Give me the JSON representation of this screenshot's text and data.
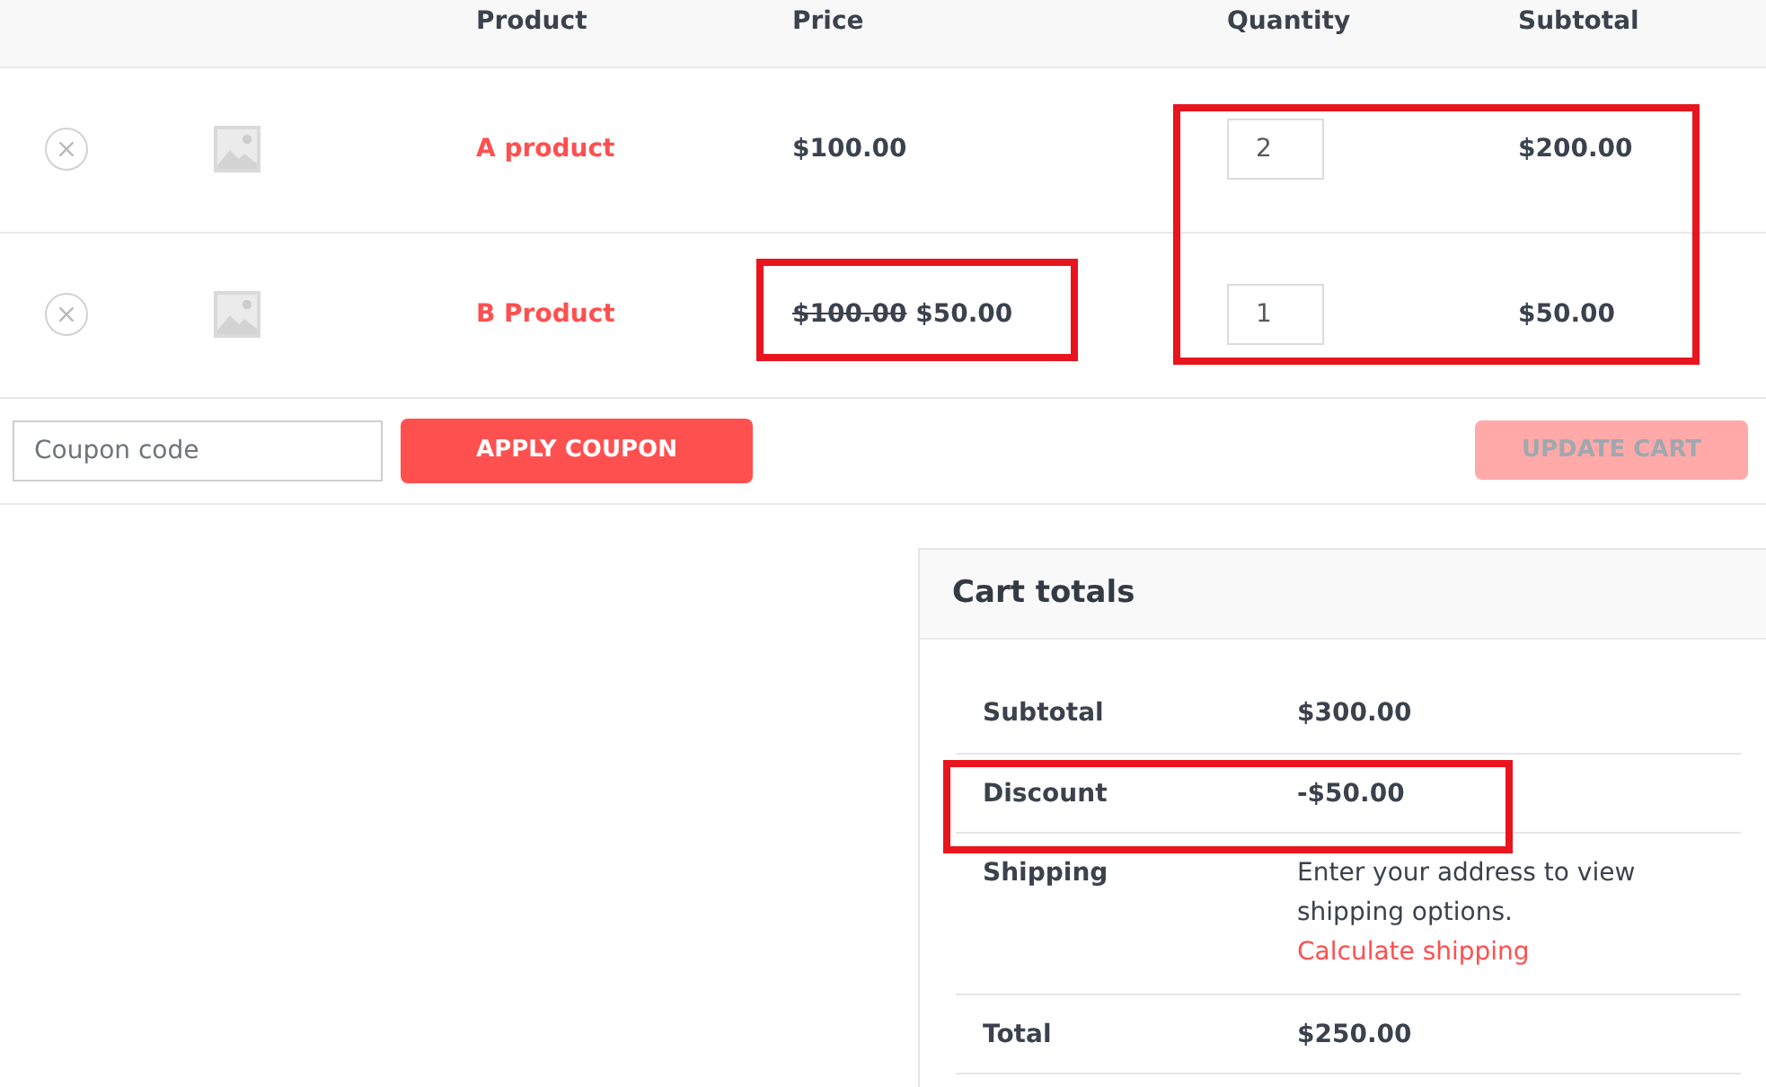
{
  "cart_table": {
    "columns": [
      {
        "label": "Product",
        "highlighted": false
      },
      {
        "label": "Price",
        "highlighted": false
      },
      {
        "label": "Quantity",
        "highlighted": true
      },
      {
        "label": "Subtotal",
        "highlighted": true
      }
    ],
    "rows": [
      {
        "product": "A product",
        "price": "$100.00",
        "price_highlighted": false,
        "quantity": "2",
        "subtotal": "$200.00"
      },
      {
        "product": "B Product",
        "regular_price": "$100.00",
        "price": "$50.00",
        "price_highlighted": true,
        "quantity": "1",
        "subtotal": "$50.00"
      }
    ]
  },
  "coupon": {
    "placeholder": "Coupon code",
    "apply_button": "APPLY COUPON"
  },
  "update_button": {
    "label": "UPDATE CART",
    "disabled": true
  },
  "cart_totals": {
    "title": "Cart totals",
    "rows": [
      {
        "kind": "amount",
        "label": "Subtotal",
        "value": "$300.00",
        "highlighted": false
      },
      {
        "kind": "amount",
        "label": "Discount",
        "value": "-$50.00",
        "highlighted": true
      },
      {
        "kind": "shipping",
        "label": "Shipping",
        "note": "Enter your address to view shipping options.",
        "link": "Calculate shipping",
        "highlighted": false
      },
      {
        "kind": "amount",
        "label": "Total",
        "value": "$250.00",
        "highlighted": false
      }
    ]
  }
}
